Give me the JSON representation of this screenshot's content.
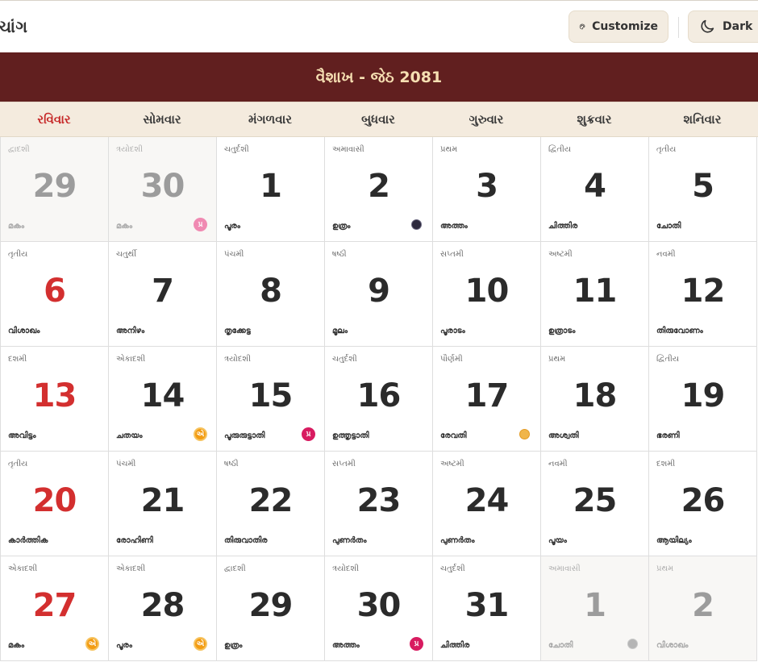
{
  "app": {
    "brand": "ચાંગ",
    "customize_label": "Customize",
    "dark_label": "Dark"
  },
  "month_title": "વૈશાખ - જેઠ 2081",
  "weekdays": [
    "રવિવાર",
    "સોમવાર",
    "મંગળવાર",
    "બુધવાર",
    "ગુરુવાર",
    "શુક્રવાર",
    "શનિવાર"
  ],
  "badge_labels": {
    "pradosh": "પ્ર",
    "ekadashi": "એ"
  },
  "colors": {
    "header_bg": "#611f1f",
    "header_text": "#f6dfb2",
    "sunday": "#d32f2f",
    "weekday_bg": "#f4ebde"
  },
  "days": [
    {
      "num": "29",
      "tithi": "દ્વાદશી",
      "nak": "മകം",
      "dim": true,
      "sun": true,
      "badge": "",
      "moon": ""
    },
    {
      "num": "30",
      "tithi": "ત્રયોદશી",
      "nak": "മകം",
      "dim": true,
      "badge": "pradosh-faint",
      "moon": ""
    },
    {
      "num": "1",
      "tithi": "ચતુર્દશી",
      "nak": "പൂരം",
      "badge": "",
      "moon": ""
    },
    {
      "num": "2",
      "tithi": "અમાવાસી",
      "nak": "ഉത്രം",
      "badge": "",
      "moon": "new"
    },
    {
      "num": "3",
      "tithi": "પ્રથમ",
      "nak": "അത്തം",
      "badge": "",
      "moon": ""
    },
    {
      "num": "4",
      "tithi": "દ્વિતીય",
      "nak": "ചിത്തിര",
      "badge": "",
      "moon": ""
    },
    {
      "num": "5",
      "tithi": "તૃતીય",
      "nak": "ചോതി",
      "badge": "",
      "moon": ""
    },
    {
      "num": "6",
      "tithi": "તૃતીય",
      "nak": "വിശാഖം",
      "sun": true,
      "badge": "",
      "moon": ""
    },
    {
      "num": "7",
      "tithi": "ચતુર્થી",
      "nak": "അനിഴം",
      "badge": "",
      "moon": ""
    },
    {
      "num": "8",
      "tithi": "પંચમી",
      "nak": "തൃക്കേട്ട",
      "badge": "",
      "moon": ""
    },
    {
      "num": "9",
      "tithi": "ષષ્ઠી",
      "nak": "മൂലം",
      "badge": "",
      "moon": ""
    },
    {
      "num": "10",
      "tithi": "સપ્તમી",
      "nak": "പൂരാടം",
      "badge": "",
      "moon": ""
    },
    {
      "num": "11",
      "tithi": "અષ્ટમી",
      "nak": "ഉത്രാടം",
      "badge": "",
      "moon": ""
    },
    {
      "num": "12",
      "tithi": "નવમી",
      "nak": "തിരുവോണം",
      "badge": "",
      "moon": ""
    },
    {
      "num": "13",
      "tithi": "દશમી",
      "nak": "അവിട്ടം",
      "sun": true,
      "badge": "",
      "moon": ""
    },
    {
      "num": "14",
      "tithi": "એકાદશી",
      "nak": "ചതയം",
      "badge": "ekadashi",
      "moon": ""
    },
    {
      "num": "15",
      "tithi": "ત્રયોદશી",
      "nak": "പൂരുരുട്ടാതി",
      "badge": "pradosh",
      "moon": ""
    },
    {
      "num": "16",
      "tithi": "ચતુર્દશી",
      "nak": "ഉത്തൃട്ടാതി",
      "badge": "",
      "moon": ""
    },
    {
      "num": "17",
      "tithi": "પૌર્ણમી",
      "nak": "രേവതി",
      "badge": "",
      "moon": "full"
    },
    {
      "num": "18",
      "tithi": "પ્રથમ",
      "nak": "അശ്വതി",
      "badge": "",
      "moon": ""
    },
    {
      "num": "19",
      "tithi": "દ્વિતીય",
      "nak": "ഭരണി",
      "badge": "",
      "moon": ""
    },
    {
      "num": "20",
      "tithi": "તૃતીય",
      "nak": "കാർത്തിക",
      "sun": true,
      "badge": "",
      "moon": ""
    },
    {
      "num": "21",
      "tithi": "પંચમી",
      "nak": "രോഹിണി",
      "badge": "",
      "moon": ""
    },
    {
      "num": "22",
      "tithi": "ષષ્ઠી",
      "nak": "തിരുവാതിര",
      "badge": "",
      "moon": ""
    },
    {
      "num": "23",
      "tithi": "સપ્તમી",
      "nak": "പുണർതം",
      "badge": "",
      "moon": ""
    },
    {
      "num": "24",
      "tithi": "અષ્ટમી",
      "nak": "പുണർതം",
      "badge": "",
      "moon": ""
    },
    {
      "num": "25",
      "tithi": "નવમી",
      "nak": "പൂയം",
      "badge": "",
      "moon": ""
    },
    {
      "num": "26",
      "tithi": "દશમી",
      "nak": "ആയില്യം",
      "badge": "",
      "moon": ""
    },
    {
      "num": "27",
      "tithi": "એકાદશી",
      "nak": "മകം",
      "sun": true,
      "badge": "ekadashi",
      "moon": ""
    },
    {
      "num": "28",
      "tithi": "એકાદશી",
      "nak": "പൂരം",
      "badge": "ekadashi",
      "moon": ""
    },
    {
      "num": "29",
      "tithi": "દ્વાદશી",
      "nak": "ഉത്രം",
      "badge": "",
      "moon": ""
    },
    {
      "num": "30",
      "tithi": "ત્રયોદશી",
      "nak": "അത്തം",
      "badge": "pradosh",
      "moon": ""
    },
    {
      "num": "31",
      "tithi": "ચતુર્દશી",
      "nak": "ചിത്തിര",
      "badge": "",
      "moon": ""
    },
    {
      "num": "1",
      "tithi": "અમાવાસી",
      "nak": "ചോതി",
      "dim": true,
      "badge": "",
      "moon": "grey"
    },
    {
      "num": "2",
      "tithi": "પ્રથમ",
      "nak": "വിശാഖം",
      "dim": true,
      "badge": "",
      "moon": ""
    }
  ]
}
